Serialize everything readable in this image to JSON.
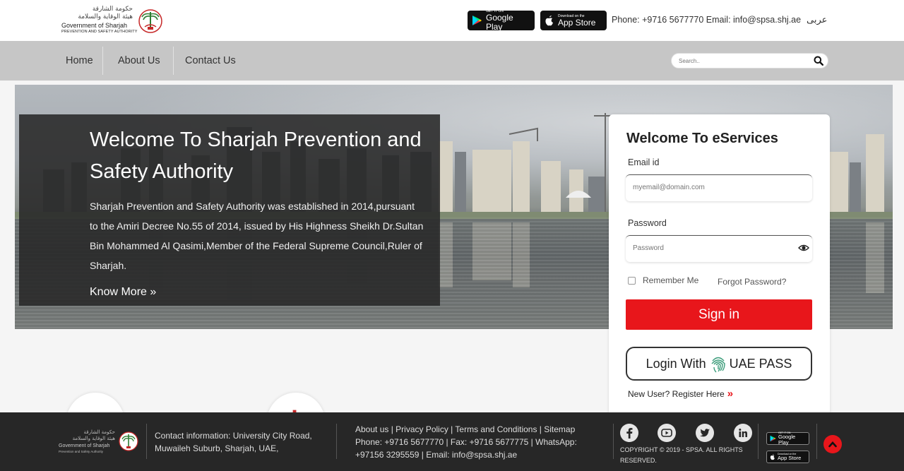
{
  "header": {
    "logo": {
      "arabic_line1": "حكومة الشارقة",
      "arabic_line2": "هيئة الوقاية والسلامة",
      "english_line1": "Government of Sharjah",
      "english_line2": "PREVENTION AND SAFETY AUTHORITY"
    },
    "google_play": {
      "small": "GET IT ON",
      "big": "Google Play"
    },
    "app_store": {
      "small": "Download on the",
      "big": "App Store"
    },
    "contact": "Phone: +9716 5677770   Email: info@spsa.shj.ae",
    "language": "عربى"
  },
  "nav": {
    "items": [
      {
        "label": "Home"
      },
      {
        "label": "About Us"
      },
      {
        "label": "Contact Us"
      }
    ],
    "search_placeholder": "Search.."
  },
  "hero": {
    "title": "Welcome To Sharjah Prevention and Safety Authority",
    "text": "Sharjah Prevention and Safety Authority was established in 2014,pursuant to the Amiri Decree No.55 of 2014, issued by His Highness Sheikh Dr.Sultan Bin Mohammed Al Qasimi,Member of the Federal Supreme Council,Ruler of Sharjah.",
    "link": "Know More »"
  },
  "login": {
    "title": "Welcome To eServices",
    "email_label": "Email id",
    "email_placeholder": "myemail@domain.com",
    "password_label": "Password",
    "password_placeholder": "Password",
    "remember_label": "Remember Me",
    "forgot_label": "Forgot Password?",
    "signin_label": "Sign in",
    "uaepass_prefix": "Login With",
    "uaepass_suffix": "UAE PASS",
    "new_user_label": "New User? Register Here",
    "new_user_chevron": "»"
  },
  "footer": {
    "logo": {
      "arabic_line1": "حكومة الشارقة",
      "arabic_line2": "هيئة الوقاية والسلامة",
      "english_line1": "Government of Sharjah",
      "english_line2": "Prevention and Safety Authority"
    },
    "contact": "Contact information: University City Road, Muwaileh Suburb, Sharjah, UAE,",
    "links_line": "About us | Privacy Policy | Terms and Conditions | Sitemap",
    "phone_line": "Phone: +9716 5677770 | Fax: +9716 5677775 | WhatsApp: +97156 3295559 | Email: info@spsa.shj.ae",
    "copyright": "COPYRIGHT © 2019 - SPSA. ALL RIGHTS RESERVED.",
    "google_play": {
      "small": "GET IT ON",
      "big": "Google Play"
    },
    "app_store": {
      "small": "Download on the",
      "big": "App Store"
    },
    "social_icons": [
      "facebook-icon",
      "youtube-icon",
      "twitter-icon",
      "linkedin-icon"
    ]
  },
  "colors": {
    "accent_red": "#e8161b",
    "nav_gray": "#c6c6c6",
    "footer_dark": "#272727"
  }
}
